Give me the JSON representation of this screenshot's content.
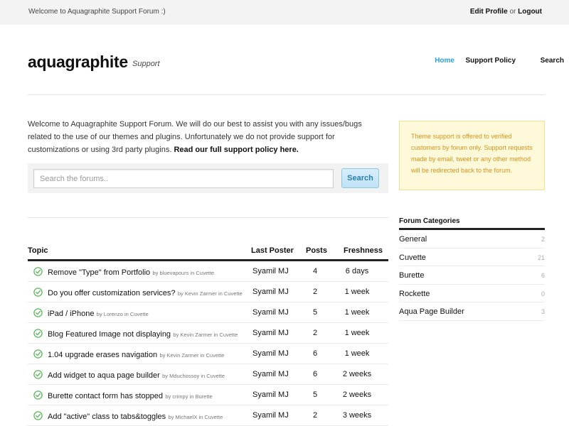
{
  "topbar": {
    "welcome": "Welcome to Aquagraphite Support Forum :)",
    "edit_profile": "Edit Profile",
    "or": "or",
    "logout": "Logout"
  },
  "header": {
    "brand": "aquagraphite",
    "tagline": "Support",
    "nav": [
      {
        "label": "Home",
        "active": true
      },
      {
        "label": "Support Policy",
        "active": false
      },
      {
        "label": "Search",
        "active": false
      }
    ]
  },
  "intro": {
    "text": "Welcome to Aquagraphite Support Forum. We will do our best to assist you with any issues/bugs related to the use of our themes and plugins. Unfortunately we do not provide support for customizations or using 3rd party plugins.",
    "policy_link": "Read our full support policy here."
  },
  "search": {
    "placeholder": "Search the forums..",
    "button": "Search"
  },
  "notice": {
    "text": "Theme support is offered to verified customers by forum only. Support requests made by email, tweet or any other method will be redirected back to the forum."
  },
  "topics": {
    "headers": {
      "topic": "Topic",
      "last_poster": "Last Poster",
      "posts": "Posts",
      "freshness": "Freshness"
    },
    "rows": [
      {
        "title": "Remove \"Type\" from Portfolio",
        "meta": "by bluevapours in Cuvette",
        "last_poster": "Syamil MJ",
        "posts": "4",
        "freshness": "6 days"
      },
      {
        "title": "Do you offer customization services?",
        "meta": "by Kevin Zarmer in Cuvette",
        "last_poster": "Syamil MJ",
        "posts": "2",
        "freshness": "1 week"
      },
      {
        "title": "iPad / iPhone",
        "meta": "by Lorenzo in Cuvette",
        "last_poster": "Syamil MJ",
        "posts": "5",
        "freshness": "1 week"
      },
      {
        "title": "Blog Featured Image not displaying",
        "meta": "by Kevin Zarmer in Cuvette",
        "last_poster": "Syamil MJ",
        "posts": "2",
        "freshness": "1 week"
      },
      {
        "title": "1.04 upgrade erases navigation",
        "meta": "by Kevin Zarmer in Cuvette",
        "last_poster": "Syamil MJ",
        "posts": "6",
        "freshness": "1 week"
      },
      {
        "title": "Add widget to aqua page builder",
        "meta": "by Mduchossoy in Cuvette",
        "last_poster": "Syamil MJ",
        "posts": "6",
        "freshness": "2 weeks"
      },
      {
        "title": "Burette contact form has stopped",
        "meta": "by crimpy in Burette",
        "last_poster": "Syamil MJ",
        "posts": "5",
        "freshness": "2 weeks"
      },
      {
        "title": "Add \"active\" class to tabs&toggles",
        "meta": "by MichaelX in Cuvette",
        "last_poster": "Syamil MJ",
        "posts": "2",
        "freshness": "3 weeks"
      }
    ]
  },
  "categories": {
    "title": "Forum Categories",
    "items": [
      {
        "name": "General",
        "count": "2"
      },
      {
        "name": "Cuvette",
        "count": "21"
      },
      {
        "name": "Burette",
        "count": "6"
      },
      {
        "name": "Rockette",
        "count": "0"
      },
      {
        "name": "Aqua Page Builder",
        "count": "3"
      }
    ]
  },
  "colors": {
    "accent": "#2a9fd8",
    "check": "#5cb85c",
    "notice_text": "#d6921d",
    "notice_bg": "#fef9d8"
  },
  "icons": {
    "topic_status": "check-circle-icon"
  }
}
